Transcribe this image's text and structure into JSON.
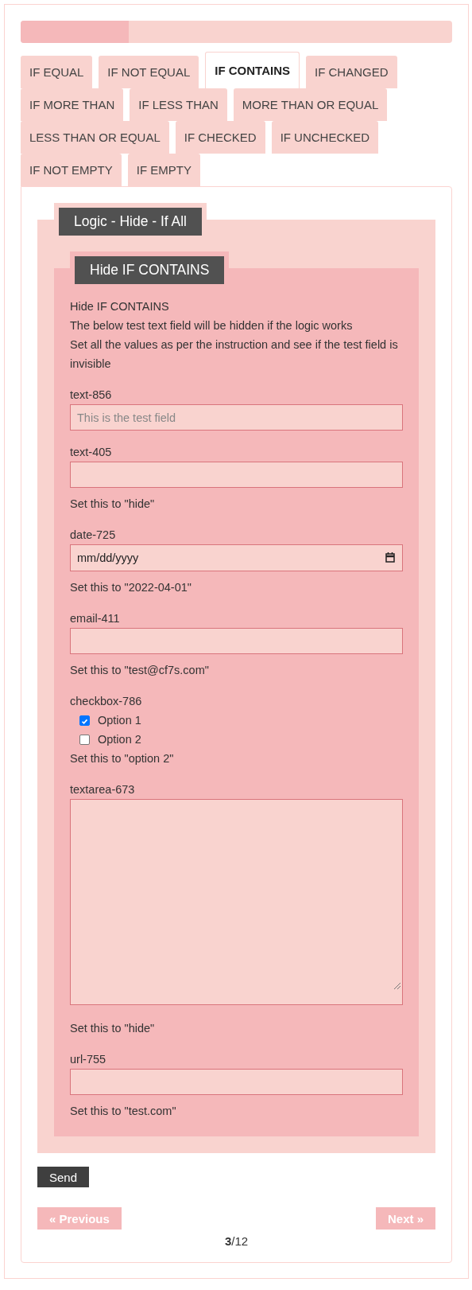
{
  "progress": {
    "level": 0.25
  },
  "tabs": [
    {
      "label": "IF EQUAL",
      "selected": false
    },
    {
      "label": "IF NOT EQUAL",
      "selected": false
    },
    {
      "label": "IF CONTAINS",
      "selected": true
    },
    {
      "label": "IF CHANGED",
      "selected": false
    },
    {
      "label": "IF MORE THAN",
      "selected": false
    },
    {
      "label": "IF LESS THAN",
      "selected": false
    },
    {
      "label": "MORE THAN OR EQUAL",
      "selected": false
    },
    {
      "label": "LESS THAN OR EQUAL",
      "selected": false
    },
    {
      "label": "IF CHECKED",
      "selected": false
    },
    {
      "label": "IF UNCHECKED",
      "selected": false
    },
    {
      "label": "IF NOT EMPTY",
      "selected": false
    },
    {
      "label": "IF EMPTY",
      "selected": false
    }
  ],
  "outer_group": {
    "legend": "Logic - Hide - If All",
    "inner_group": {
      "legend": "Hide IF CONTAINS",
      "description": [
        "Hide IF CONTAINS",
        "The below test text field will be hidden if the logic works",
        "Set all the values as per the instruction and see if the test field is invisible"
      ],
      "fields": [
        {
          "kind": "text",
          "label": "text-856",
          "placeholder": "This is the test field"
        },
        {
          "kind": "text",
          "label": "text-405",
          "note": "Set this to \"hide\""
        },
        {
          "kind": "date",
          "label": "date-725",
          "placeholder": "mm/dd/yyyy",
          "note": "Set this to \"2022-04-01\""
        },
        {
          "kind": "text",
          "label": "email-411",
          "note": "Set this to \"test@cf7s.com\""
        },
        {
          "kind": "checkbox",
          "label": "checkbox-786",
          "options": [
            {
              "label": "Option 1",
              "checked": true
            },
            {
              "label": "Option 2",
              "checked": false
            }
          ],
          "note": "Set this to \"option 2\""
        },
        {
          "kind": "textarea",
          "label": "textarea-673",
          "note": "Set this to \"hide\""
        },
        {
          "kind": "text",
          "label": "url-755",
          "note": "Set this to \"test.com\""
        }
      ]
    }
  },
  "send_button": "Send",
  "pager": {
    "previous": "« Previous",
    "next": "Next »",
    "count": "**3**/12"
  }
}
